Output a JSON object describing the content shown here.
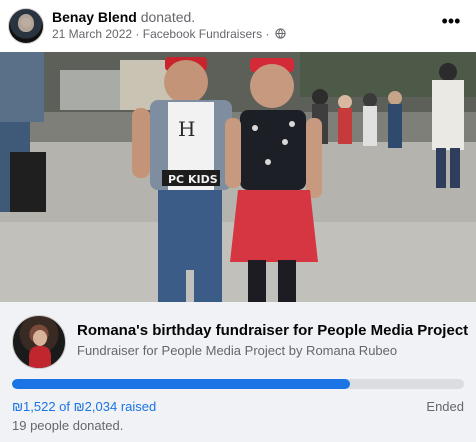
{
  "post": {
    "author_name": "Benay Blend",
    "action": "donated.",
    "date": "21 March 2022",
    "separator": "·",
    "source": "Facebook Fundraisers",
    "separator2": "·",
    "more_label": "•••"
  },
  "fundraiser": {
    "title": "Romana's birthday fundraiser for People Media Project",
    "subtitle": "Fundraiser for People Media Project by Romana Rubeo",
    "raised_text": "₪1,522 of ₪2,034 raised",
    "progress": 0.748,
    "status": "Ended",
    "donors_text": "19 people donated."
  },
  "photo": {
    "shirt_text_1": "H",
    "shirt_text_2": "PC KIDS"
  },
  "colors": {
    "accent": "#1b74e4",
    "card_bg": "#f0f2f5",
    "muted": "#65676b"
  }
}
